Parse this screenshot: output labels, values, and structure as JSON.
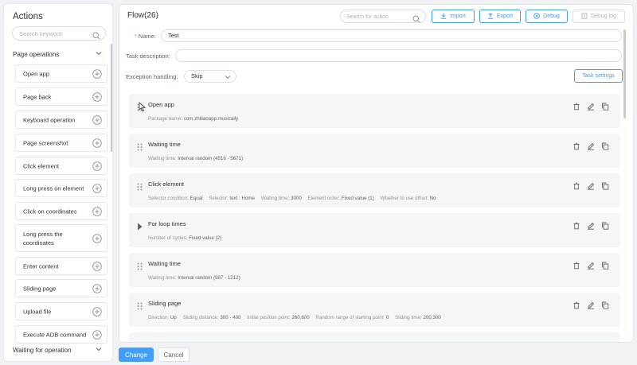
{
  "sidebar": {
    "title": "Actions",
    "search_placeholder": "Search keyword",
    "section_page": "Page operations",
    "items": [
      {
        "label": "Open app"
      },
      {
        "label": "Page back"
      },
      {
        "label": "Keyboard operation"
      },
      {
        "label": "Page screenshot"
      },
      {
        "label": "Click element"
      },
      {
        "label": "Long press on element"
      },
      {
        "label": "Click on coordinates"
      },
      {
        "label": "Long press the coordinates"
      },
      {
        "label": "Enter content"
      },
      {
        "label": "Sliding page"
      },
      {
        "label": "Upload file"
      },
      {
        "label": "Execute ADB command"
      }
    ],
    "section_waiting": "Waiting for operation"
  },
  "header": {
    "title": "Flow(26)",
    "search_placeholder": "Search for action",
    "import_label": "Import",
    "export_label": "Export",
    "debug_label": "Debug",
    "debug_log_label": "Debug log"
  },
  "form": {
    "name_label": "Name:",
    "name_value": "Test",
    "desc_label": "Task description:",
    "desc_value": "",
    "exception_label": "Exception handling:",
    "exception_value": "Skip",
    "task_settings_label": "Task settings"
  },
  "steps": [
    {
      "name": "Open app",
      "detail": [
        {
          "k": "Package name:",
          "v": "com.zhiliaoapp.musically"
        }
      ]
    },
    {
      "name": "Waiting time",
      "detail": [
        {
          "k": "Waiting time:",
          "v": "Interval random (4516 - 5671)"
        }
      ]
    },
    {
      "name": "Click element",
      "detail": [
        {
          "k": "Selector condition:",
          "v": "Equal"
        },
        {
          "k": "Selector:",
          "v": "text : Home"
        },
        {
          "k": "Waiting time:",
          "v": "3000"
        },
        {
          "k": "Element order:",
          "v": "Fixed value (1)"
        },
        {
          "k": "Whether to use offset:",
          "v": "No"
        }
      ]
    },
    {
      "name": "For loop times",
      "detail": [
        {
          "k": "Number of cycles:",
          "v": "Fixed value (2)"
        }
      ]
    },
    {
      "name": "Waiting time",
      "detail": [
        {
          "k": "Waiting time:",
          "v": "Interval random (987 - 1212)"
        }
      ]
    },
    {
      "name": "Sliding page",
      "detail": [
        {
          "k": "Direction:",
          "v": "Up"
        },
        {
          "k": "Sliding distance:",
          "v": "300 - 400"
        },
        {
          "k": "Initial position point:",
          "v": "260,600"
        },
        {
          "k": "Random range of starting point:",
          "v": "0"
        },
        {
          "k": "Sliding time:",
          "v": "200,300"
        }
      ]
    }
  ],
  "footer": {
    "change_label": "Change",
    "cancel_label": "Cancel"
  },
  "colors": {
    "accent": "#409eff",
    "required": "#f56c6c",
    "card_bg": "#f5f6f8"
  }
}
